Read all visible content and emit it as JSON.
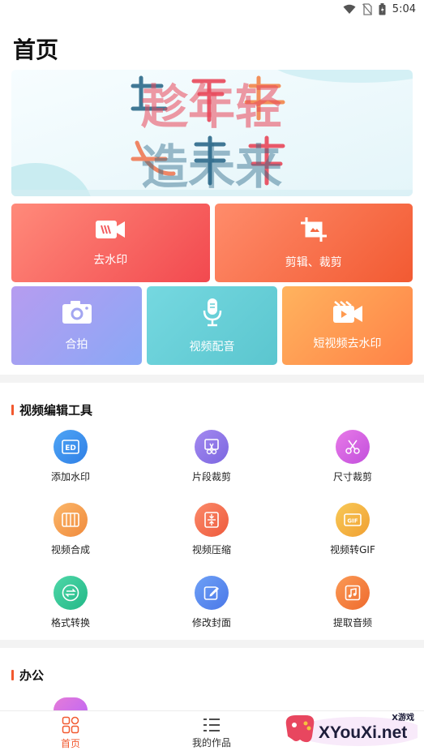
{
  "status_bar": {
    "time": "5:04",
    "icons": [
      "wifi-icon",
      "no-sim-icon",
      "battery-icon"
    ]
  },
  "page": {
    "title": "首页"
  },
  "banner": {
    "line1": "趁年轻",
    "line2": "造未来"
  },
  "feature_tiles": [
    {
      "label": "去水印",
      "icon": "video-remove-watermark-icon"
    },
    {
      "label": "剪辑、裁剪",
      "icon": "crop-icon"
    },
    {
      "label": "合拍",
      "icon": "camera-icon"
    },
    {
      "label": "视频配音",
      "icon": "microphone-icon"
    },
    {
      "label": "短视频去水印",
      "icon": "clapper-video-icon"
    }
  ],
  "video_tools": {
    "title": "视频编辑工具",
    "items": [
      {
        "label": "添加水印",
        "icon": "watermark-icon",
        "color": "#3f8ff0"
      },
      {
        "label": "片段裁剪",
        "icon": "scissors-clip-icon",
        "color": "#8a72e8"
      },
      {
        "label": "尺寸裁剪",
        "icon": "scissors-icon",
        "color": "#d35fe0"
      },
      {
        "label": "视频合成",
        "icon": "merge-icon",
        "color": "#f49a4f"
      },
      {
        "label": "视频压缩",
        "icon": "compress-icon",
        "color": "#f26a4e"
      },
      {
        "label": "视频转GIF",
        "icon": "gif-icon",
        "color": "#f3b23e"
      },
      {
        "label": "格式转换",
        "icon": "convert-icon",
        "color": "#36c49a"
      },
      {
        "label": "修改封面",
        "icon": "edit-cover-icon",
        "color": "#5b8df0"
      },
      {
        "label": "提取音频",
        "icon": "music-note-icon",
        "color": "#f47a3d"
      }
    ]
  },
  "office": {
    "title": "办公"
  },
  "bottom_nav": {
    "items": [
      {
        "label": "首页",
        "icon": "home-grid-icon",
        "active": true
      },
      {
        "label": "我的作品",
        "icon": "list-icon",
        "active": false
      }
    ]
  },
  "watermark": {
    "brand": "XYouXi.net",
    "sub": "X游戏"
  },
  "colors": {
    "accent": "#f2592f",
    "background": "#ffffff",
    "divider": "#f3f3f3"
  }
}
